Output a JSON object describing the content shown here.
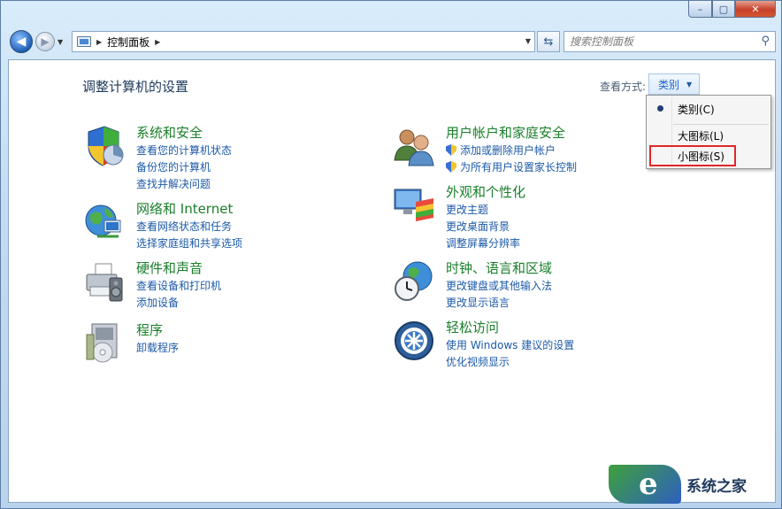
{
  "window": {
    "minimize_glyph": "–",
    "maximize_glyph": "▢",
    "close_glyph": "✕"
  },
  "address": {
    "crumb": "控制面板",
    "search_placeholder": "搜索控制面板"
  },
  "page": {
    "title": "调整计算机的设置",
    "view_by_label": "查看方式:",
    "view_by_value": "类别"
  },
  "categories": [
    {
      "icon": "security-shield-icon",
      "title": "系统和安全",
      "links": [
        "查看您的计算机状态",
        "备份您的计算机",
        "查找并解决问题"
      ]
    },
    {
      "icon": "network-globe-icon",
      "title": "网络和 Internet",
      "links": [
        "查看网络状态和任务",
        "选择家庭组和共享选项"
      ]
    },
    {
      "icon": "printer-icon",
      "title": "硬件和声音",
      "links": [
        "查看设备和打印机",
        "添加设备"
      ]
    },
    {
      "icon": "programs-icon",
      "title": "程序",
      "links": [
        "卸载程序"
      ]
    },
    {
      "icon": "users-icon",
      "title": "用户帐户和家庭安全",
      "links": [
        "添加或删除用户帐户",
        "为所有用户设置家长控制"
      ]
    },
    {
      "icon": "display-palette-icon",
      "title": "外观和个性化",
      "links": [
        "更改主题",
        "更改桌面背景",
        "调整屏幕分辨率"
      ]
    },
    {
      "icon": "clock-globe-icon",
      "title": "时钟、语言和区域",
      "links": [
        "更改键盘或其他输入法",
        "更改显示语言"
      ]
    },
    {
      "icon": "ease-of-access-icon",
      "title": "轻松访问",
      "links": [
        "使用 Windows 建议的设置",
        "优化视频显示"
      ]
    }
  ],
  "view_menu": {
    "items": [
      "类别(C)",
      "大图标(L)",
      "小图标(S)"
    ],
    "selected": "类别(C)",
    "highlighted": "小图标(S)"
  },
  "watermark": {
    "text": "系统之家"
  },
  "colors": {
    "category_title": "#1a7f2a",
    "link": "#1c5aa8",
    "highlight_box": "#e0262b"
  }
}
